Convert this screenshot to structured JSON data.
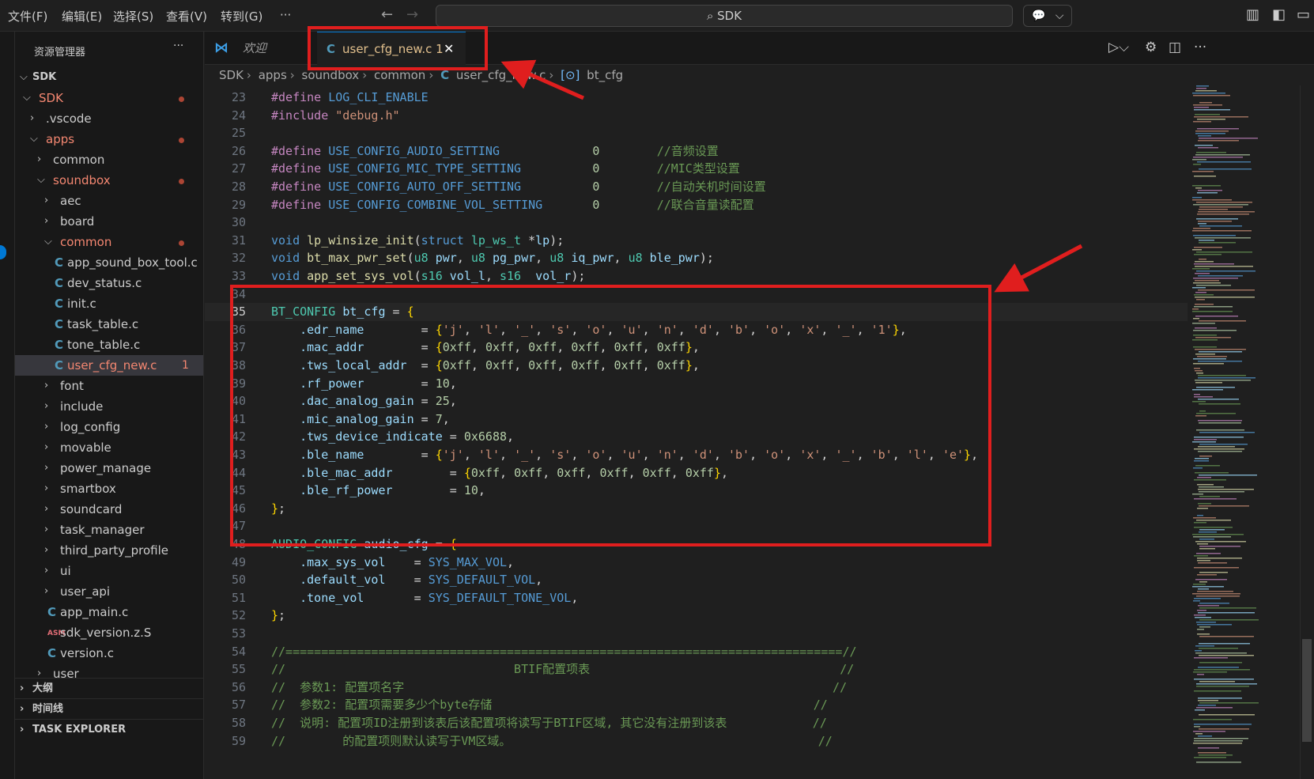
{
  "menu": {
    "items": [
      "文件(F)",
      "编辑(E)",
      "选择(S)",
      "查看(V)",
      "转到(G)",
      "···"
    ],
    "search": "SDK",
    "copilot": "⌵"
  },
  "sidebar": {
    "title": "资源管理器",
    "more": "···",
    "root": "SDK",
    "tree": [
      {
        "label": "SDK",
        "chev": "⌵",
        "lvl": 1,
        "modified": true
      },
      {
        "label": ".vscode",
        "chev": "›",
        "lvl": 2
      },
      {
        "label": "apps",
        "chev": "⌵",
        "lvl": 2,
        "modified": true
      },
      {
        "label": "common",
        "chev": "›",
        "lvl": 3
      },
      {
        "label": "soundbox",
        "chev": "⌵",
        "lvl": 3,
        "modified": true
      },
      {
        "label": "aec",
        "chev": "›",
        "lvl": 4
      },
      {
        "label": "board",
        "chev": "›",
        "lvl": 4
      },
      {
        "label": "common",
        "chev": "⌵",
        "lvl": 4,
        "modified": true
      },
      {
        "label": "app_sound_box_tool.c",
        "icon": "C",
        "lvl": 5
      },
      {
        "label": "dev_status.c",
        "icon": "C",
        "lvl": 5
      },
      {
        "label": "init.c",
        "icon": "C",
        "lvl": 5
      },
      {
        "label": "task_table.c",
        "icon": "C",
        "lvl": 5
      },
      {
        "label": "tone_table.c",
        "icon": "C",
        "lvl": 5
      },
      {
        "label": "user_cfg_new.c",
        "icon": "C",
        "lvl": 5,
        "active": true,
        "count": "1"
      },
      {
        "label": "font",
        "chev": "›",
        "lvl": 4
      },
      {
        "label": "include",
        "chev": "›",
        "lvl": 4
      },
      {
        "label": "log_config",
        "chev": "›",
        "lvl": 4
      },
      {
        "label": "movable",
        "chev": "›",
        "lvl": 4
      },
      {
        "label": "power_manage",
        "chev": "›",
        "lvl": 4
      },
      {
        "label": "smartbox",
        "chev": "›",
        "lvl": 4
      },
      {
        "label": "soundcard",
        "chev": "›",
        "lvl": 4
      },
      {
        "label": "task_manager",
        "chev": "›",
        "lvl": 4
      },
      {
        "label": "third_party_profile",
        "chev": "›",
        "lvl": 4
      },
      {
        "label": "ui",
        "chev": "›",
        "lvl": 4
      },
      {
        "label": "user_api",
        "chev": "›",
        "lvl": 4
      },
      {
        "label": "app_main.c",
        "icon": "C",
        "lvl": 4
      },
      {
        "label": "sdk_version.z.S",
        "icon": "ASM",
        "lvl": 4
      },
      {
        "label": "version.c",
        "icon": "C",
        "lvl": 4
      },
      {
        "label": "user",
        "chev": "›",
        "lvl": 3
      }
    ],
    "panels": [
      "大纲",
      "时间线",
      "TASK EXPLORER"
    ]
  },
  "tabs": {
    "welcome": "欢迎",
    "active": "user_cfg_new.c 1",
    "close": "✕"
  },
  "breadcrumb": [
    "SDK",
    "apps",
    "soundbox",
    "common",
    "user_cfg_new.c",
    "bt_cfg"
  ],
  "code": [
    {
      "n": "23",
      "t": "#define LOG_CLI_ENABLE"
    },
    {
      "n": "24",
      "t": "#include \"debug.h\""
    },
    {
      "n": "25",
      "t": ""
    },
    {
      "n": "26",
      "t": "#define USE_CONFIG_AUDIO_SETTING             0        //音频设置"
    },
    {
      "n": "27",
      "t": "#define USE_CONFIG_MIC_TYPE_SETTING          0        //MIC类型设置"
    },
    {
      "n": "28",
      "t": "#define USE_CONFIG_AUTO_OFF_SETTING          0        //自动关机时间设置"
    },
    {
      "n": "29",
      "t": "#define USE_CONFIG_COMBINE_VOL_SETTING       0        //联合音量读配置"
    },
    {
      "n": "30",
      "t": ""
    },
    {
      "n": "31",
      "t": "void lp_winsize_init(struct lp_ws_t *lp);"
    },
    {
      "n": "32",
      "t": "void bt_max_pwr_set(u8 pwr, u8 pg_pwr, u8 iq_pwr, u8 ble_pwr);"
    },
    {
      "n": "33",
      "t": "void app_set_sys_vol(s16 vol_l, s16  vol_r);"
    },
    {
      "n": "34",
      "t": ""
    },
    {
      "n": "35",
      "t": "BT_CONFIG bt_cfg = {"
    },
    {
      "n": "36",
      "t": "    .edr_name        = {'j', 'l', '_', 's', 'o', 'u', 'n', 'd', 'b', 'o', 'x', '_', '1'},"
    },
    {
      "n": "37",
      "t": "    .mac_addr        = {0xff, 0xff, 0xff, 0xff, 0xff, 0xff},"
    },
    {
      "n": "38",
      "t": "    .tws_local_addr  = {0xff, 0xff, 0xff, 0xff, 0xff, 0xff},"
    },
    {
      "n": "39",
      "t": "    .rf_power        = 10,"
    },
    {
      "n": "40",
      "t": "    .dac_analog_gain = 25,"
    },
    {
      "n": "41",
      "t": "    .mic_analog_gain = 7,"
    },
    {
      "n": "42",
      "t": "    .tws_device_indicate = 0x6688,"
    },
    {
      "n": "43",
      "t": "    .ble_name        = {'j', 'l', '_', 's', 'o', 'u', 'n', 'd', 'b', 'o', 'x', '_', 'b', 'l', 'e'},"
    },
    {
      "n": "44",
      "t": "    .ble_mac_addr        = {0xff, 0xff, 0xff, 0xff, 0xff, 0xff},"
    },
    {
      "n": "45",
      "t": "    .ble_rf_power        = 10,"
    },
    {
      "n": "46",
      "t": "};"
    },
    {
      "n": "47",
      "t": ""
    },
    {
      "n": "48",
      "t": "AUDIO_CONFIG audio_cfg = {"
    },
    {
      "n": "49",
      "t": "    .max_sys_vol    = SYS_MAX_VOL,"
    },
    {
      "n": "50",
      "t": "    .default_vol    = SYS_DEFAULT_VOL,"
    },
    {
      "n": "51",
      "t": "    .tone_vol       = SYS_DEFAULT_TONE_VOL,"
    },
    {
      "n": "52",
      "t": "};"
    },
    {
      "n": "53",
      "t": ""
    },
    {
      "n": "54",
      "t": "//==============================================================================//"
    },
    {
      "n": "55",
      "t": "//                                BTIF配置项表                                   //"
    },
    {
      "n": "56",
      "t": "//  参数1: 配置项名字                                                            //"
    },
    {
      "n": "57",
      "t": "//  参数2: 配置项需要多少个byte存储                                             //"
    },
    {
      "n": "58",
      "t": "//  说明: 配置项ID注册到该表后该配置项将读写于BTIF区域, 其它没有注册到该表            //"
    },
    {
      "n": "59",
      "t": "//        的配置项则默认读写于VM区域。                                           //"
    }
  ],
  "colors": {
    "accent": "#0078d4",
    "annotation": "#e01e1e",
    "modified": "#e2c08d"
  }
}
